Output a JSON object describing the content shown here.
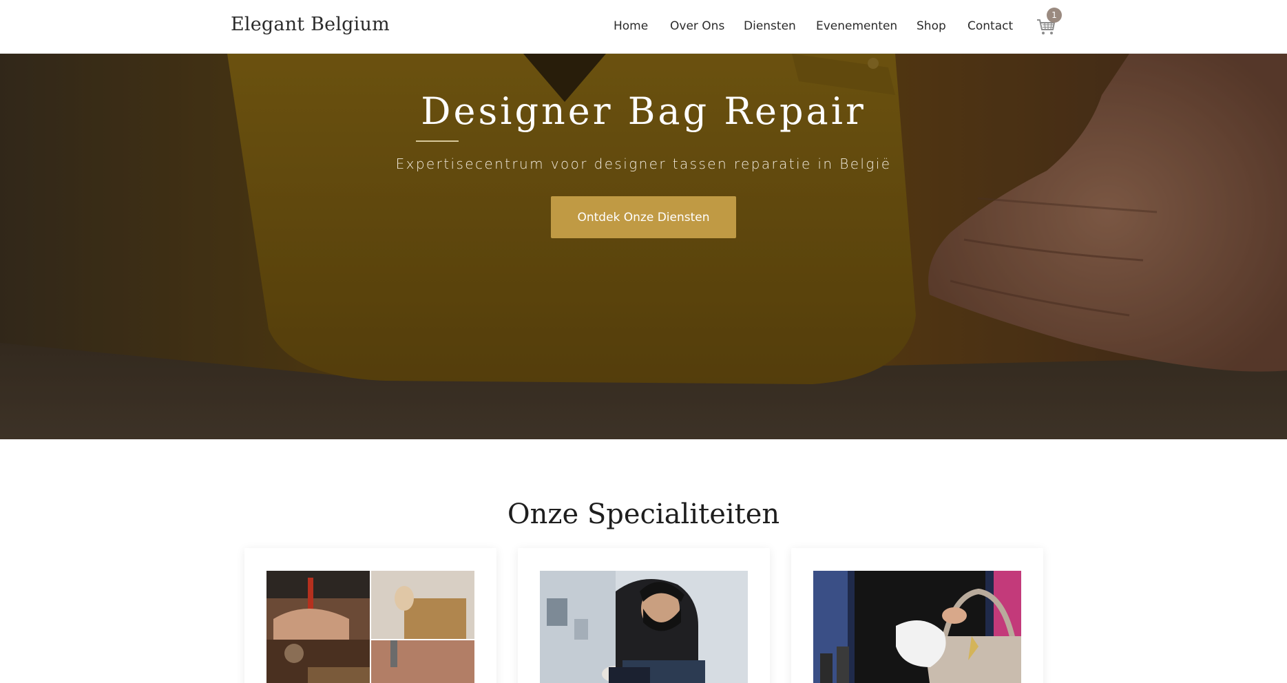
{
  "header": {
    "logo": "Elegant Belgium",
    "nav": [
      "Home",
      "Over Ons",
      "Diensten",
      "Evenementen",
      "Shop",
      "Contact"
    ],
    "cart": {
      "icon": "shopping-cart-icon",
      "count": "1"
    }
  },
  "hero": {
    "title": "Designer Bag Repair",
    "subtitle": "Expertisecentrum voor designer tassen reparatie in België",
    "cta": "Ontdek Onze Diensten"
  },
  "specialities": {
    "title": "Onze Specialiteiten"
  },
  "colors": {
    "accent_gold": "#c09a44",
    "cart_badge": "#9a8a80",
    "hero_overlay": "#3a2a14"
  }
}
